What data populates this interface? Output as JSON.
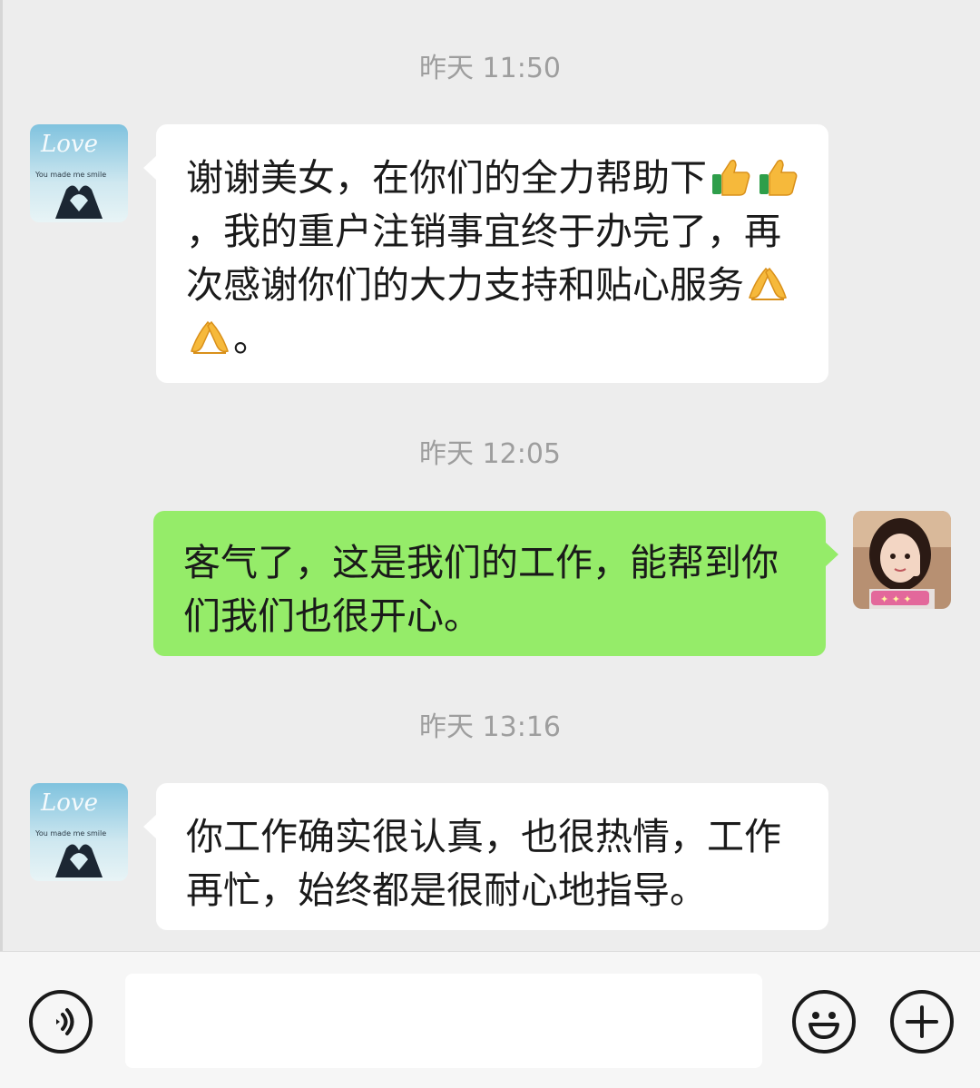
{
  "messages": [
    {
      "time": "昨天 11:50",
      "direction": "incoming",
      "parts": [
        "谢谢美女，在你们的全力帮助下",
        {
          "emoji": "thumbs-up-icon"
        },
        {
          "emoji": "thumbs-up-icon"
        },
        "，我的重户注销事宜终于办完了，再次感谢你们的大力支持和贴心服务",
        {
          "emoji": "bow-hands-icon"
        },
        {
          "emoji": "bow-hands-icon"
        },
        "。"
      ]
    },
    {
      "time": "昨天 12:05",
      "direction": "outgoing",
      "text": "客气了，这是我们的工作，能帮到你们我们也很开心。"
    },
    {
      "time": "昨天 13:16",
      "direction": "incoming",
      "text": "你工作确实很认真，也很热情，工作再忙，始终都是很耐心地指导。"
    }
  ],
  "avatar_caption": "You made me smile",
  "input_bar": {
    "value": "",
    "icons": [
      "voice-icon",
      "emoji-face-icon",
      "plus-icon"
    ]
  },
  "colors": {
    "background": "#ededed",
    "incoming_bubble": "#ffffff",
    "outgoing_bubble": "#95ec69",
    "timestamp": "#9e9e9e"
  }
}
